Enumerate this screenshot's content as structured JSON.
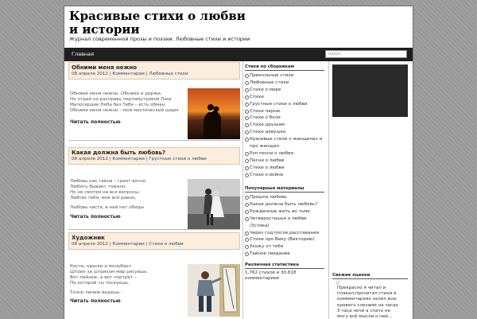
{
  "site": {
    "title": "Красивые стихи о любви и истории",
    "description": "Журнал современной прозы и поэзии. Любовные стихи и истории"
  },
  "nav": {
    "home": "Главная"
  },
  "search": {
    "placeholder": "поиск"
  },
  "posts": [
    {
      "title": "Обними меня нежно",
      "date": "08 апреля 2012",
      "comments": "Комментарии",
      "category": "Любовные стихи",
      "lines": [
        "Обними меня нежно. Обними и держи.",
        "Не отдай на расправу перламутровой Лжи.",
        "Милосердие Неба без Тебя – есть обман.",
        "Обними меня нежно – мой мистический шарм."
      ],
      "readmore": "Читать полностью"
    },
    {
      "title": "Какая должна быть любовь?",
      "date": "08 апреля 2012",
      "comments": "Комментарии",
      "category": "Грустные стихи о любви",
      "lines": [
        "Любовь как тайна – греет вечно",
        "Любить бывает тяжело,",
        "Но не смотря на все вопросы,",
        "Люблю тебя, мне всё равно,",
        "",
        "Любовь чиста, в ней нет обиды"
      ],
      "readmore": "Читать полностью"
    },
    {
      "title": "Художник",
      "date": "08 апреля 2012",
      "comments": "Комментарии",
      "category": "Стихи о любви",
      "lines": [
        "Кисти, краски и мольберт.",
        "Штрих за штрихом мир рисуешь.",
        "Вот пейзаж, а вот портрет –",
        "По которой ты тоскуешь.",
        "",
        "Точно линию ведешь -"
      ],
      "readmore": "Читать полностью"
    }
  ],
  "sidebar": {
    "collections": {
      "heading": "Стихи по сборникам",
      "items": [
        "Прикольные стихи",
        "Любовные стихи",
        "Стихи о мире",
        "Стихи",
        "Грустные стихи о любви",
        "Стихи парню",
        "Стихи о боли",
        "Стихи друзьям",
        "Стихи девушке",
        "Красивые стихи о женщинах и про женщин",
        "Рэп песни о любви",
        "Песни о любви",
        "Стихи о любви",
        "Стихи о войне"
      ]
    },
    "popular": {
      "heading": "Популярные материалы",
      "items": [
        "Прошла любовь",
        "Какая должна быть любовь?",
        "Рожденные жить во тьме",
        "Четверостишья о любви (3стика)",
        "Через год после расставания",
        "Стихи про Вику (Викторию)",
        "Ухожу от тебя",
        "Тайное свидание"
      ]
    },
    "stats": {
      "heading": "Различная статистика",
      "text": "1,762 стихов и 30,618 комментариев"
    }
  },
  "right": {
    "reviews_heading": "Свежие оценки",
    "comment": "Прекрасно я читал и плакал,прочитал стихи в комментариях залил всю кровать слезами на часах 3 часа ночи а спать не могу всё мысли о ней..."
  },
  "colors": {
    "nav_bg": "#1f1f1f",
    "post_head_bg": "#fbeedd",
    "page_bg": "#9c9c9c"
  }
}
